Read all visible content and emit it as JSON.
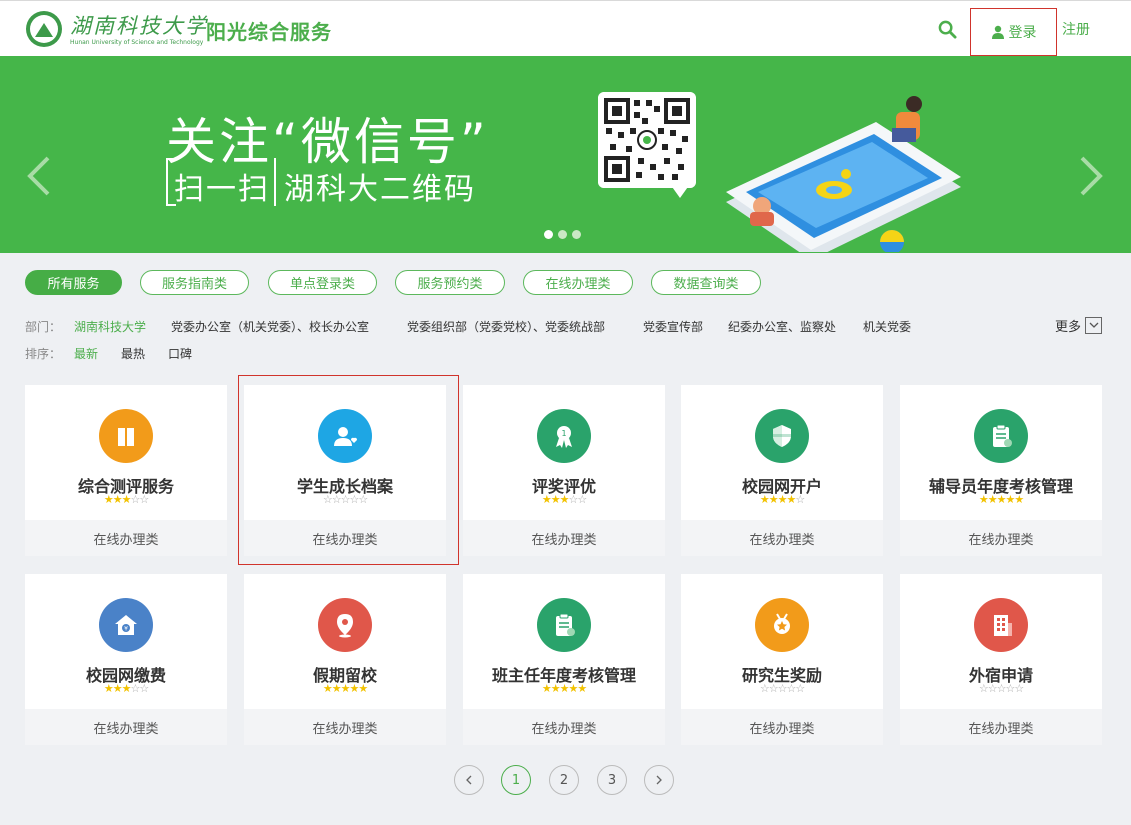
{
  "header": {
    "logo_text": "湖南科技大学",
    "logo_subtext": "Hunan University of Science and Technology",
    "site_name": "阳光综合服务",
    "login_label": "登录",
    "register_label": "注册"
  },
  "banner": {
    "line1": "关注“微信号”",
    "line2_bracket": "扫一扫",
    "line2_text": "湖科大二维码",
    "slides": 3,
    "active_slide": 1
  },
  "filters": {
    "tabs": [
      "所有服务",
      "服务指南类",
      "单点登录类",
      "服务预约类",
      "在线办理类",
      "数据查询类"
    ],
    "active_tab": 0,
    "dept_label": "部门：",
    "departments": [
      "湖南科技大学",
      "党委办公室（机关党委）、校长办公室",
      "党委组织部（党委党校）、党委统战部",
      "党委宣传部",
      "纪委办公室、监察处",
      "机关党委"
    ],
    "more_label": "更多",
    "sort_label": "排序：",
    "sort_options": [
      "最新",
      "最热",
      "口碑"
    ],
    "active_sort": 0
  },
  "services": [
    {
      "title": "综合测评服务",
      "category": "在线办理类",
      "rating": 3,
      "color": "#f29b1a",
      "icon": "book-icon"
    },
    {
      "title": "学生成长档案",
      "category": "在线办理类",
      "rating": 0,
      "color": "#1ea6e4",
      "icon": "student-profile-icon"
    },
    {
      "title": "评奖评优",
      "category": "在线办理类",
      "rating": 3,
      "color": "#2aa36b",
      "icon": "medal-icon"
    },
    {
      "title": "校园网开户",
      "category": "在线办理类",
      "rating": 4,
      "color": "#2aa36b",
      "icon": "shield-icon"
    },
    {
      "title": "辅导员年度考核管理",
      "category": "在线办理类",
      "rating": 5,
      "color": "#2aa36b",
      "icon": "clipboard-icon"
    },
    {
      "title": "校园网缴费",
      "category": "在线办理类",
      "rating": 3,
      "color": "#4a82c8",
      "icon": "house-payment-icon"
    },
    {
      "title": "假期留校",
      "category": "在线办理类",
      "rating": 5,
      "color": "#e0574a",
      "icon": "location-pin-icon"
    },
    {
      "title": "班主任年度考核管理",
      "category": "在线办理类",
      "rating": 5,
      "color": "#2aa36b",
      "icon": "clipboard-icon"
    },
    {
      "title": "研究生奖励",
      "category": "在线办理类",
      "rating": 0,
      "color": "#f29b1a",
      "icon": "award-icon"
    },
    {
      "title": "外宿申请",
      "category": "在线办理类",
      "rating": 0,
      "color": "#e0574a",
      "icon": "building-icon"
    }
  ],
  "pagination": {
    "pages": [
      "1",
      "2",
      "3"
    ],
    "current": "1"
  },
  "colors": {
    "brand_green": "#4cae4c",
    "banner_green": "#45b649",
    "star_gold": "#f2c200",
    "highlight_red": "#d0342c"
  }
}
